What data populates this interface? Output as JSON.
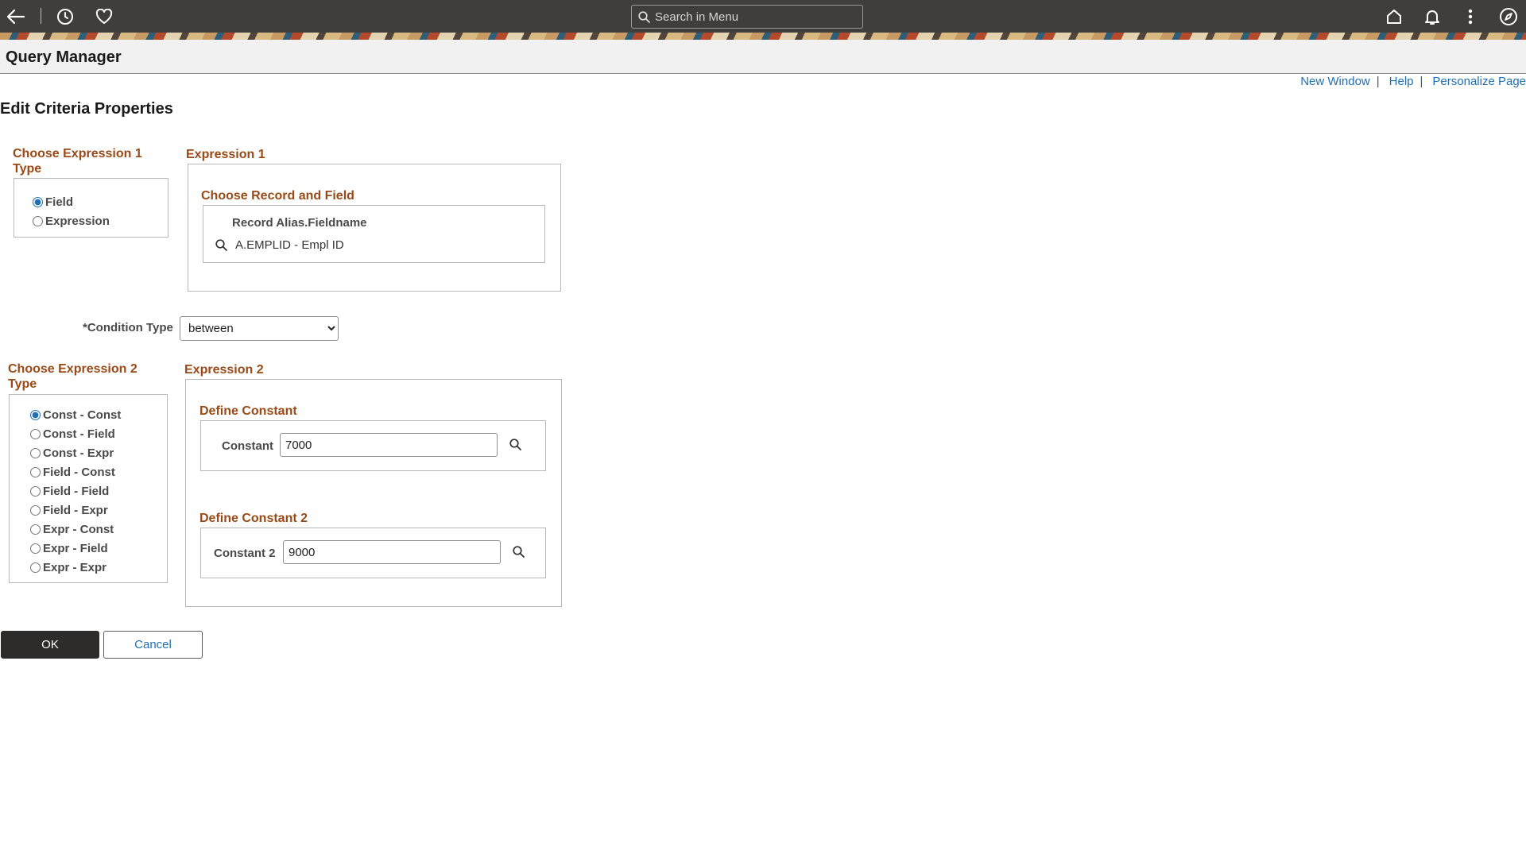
{
  "topbar": {
    "search_placeholder": "Search in Menu",
    "icons": [
      "back-arrow-icon",
      "history-icon",
      "favorites-heart-icon",
      "home-icon",
      "notification-bell-icon",
      "more-vertical-icon",
      "navigator-compass-icon"
    ]
  },
  "header": {
    "title": "Query Manager"
  },
  "links": {
    "new_window": "New Window",
    "help": "Help",
    "personalize": "Personalize Page",
    "separator": "|"
  },
  "page": {
    "heading": "Edit Criteria Properties"
  },
  "expr1_type": {
    "title": "Choose Expression 1 Type",
    "options": [
      "Field",
      "Expression"
    ],
    "selected": "Field"
  },
  "expr1": {
    "title": "Expression 1",
    "record_title": "Choose Record and Field",
    "column_header": "Record Alias.Fieldname",
    "value": "A.EMPLID - Empl ID"
  },
  "condition": {
    "label": "*Condition Type",
    "selected": "between"
  },
  "expr2_type": {
    "title": "Choose Expression 2 Type",
    "options": [
      "Const - Const",
      "Const - Field",
      "Const - Expr",
      "Field - Const",
      "Field - Field",
      "Field - Expr",
      "Expr - Const",
      "Expr - Field",
      "Expr - Expr"
    ],
    "selected": "Const - Const"
  },
  "expr2": {
    "title": "Expression 2",
    "const1_title": "Define Constant",
    "const1_label": "Constant",
    "const1_value": "7000",
    "const2_title": "Define Constant 2",
    "const2_label": "Constant 2",
    "const2_value": "9000"
  },
  "buttons": {
    "ok": "OK",
    "cancel": "Cancel"
  },
  "colors": {
    "topbar": "#3f3e3d",
    "group_title": "#9a4a16",
    "link": "#1f6fb5",
    "ok_button": "#2e2c2a"
  }
}
